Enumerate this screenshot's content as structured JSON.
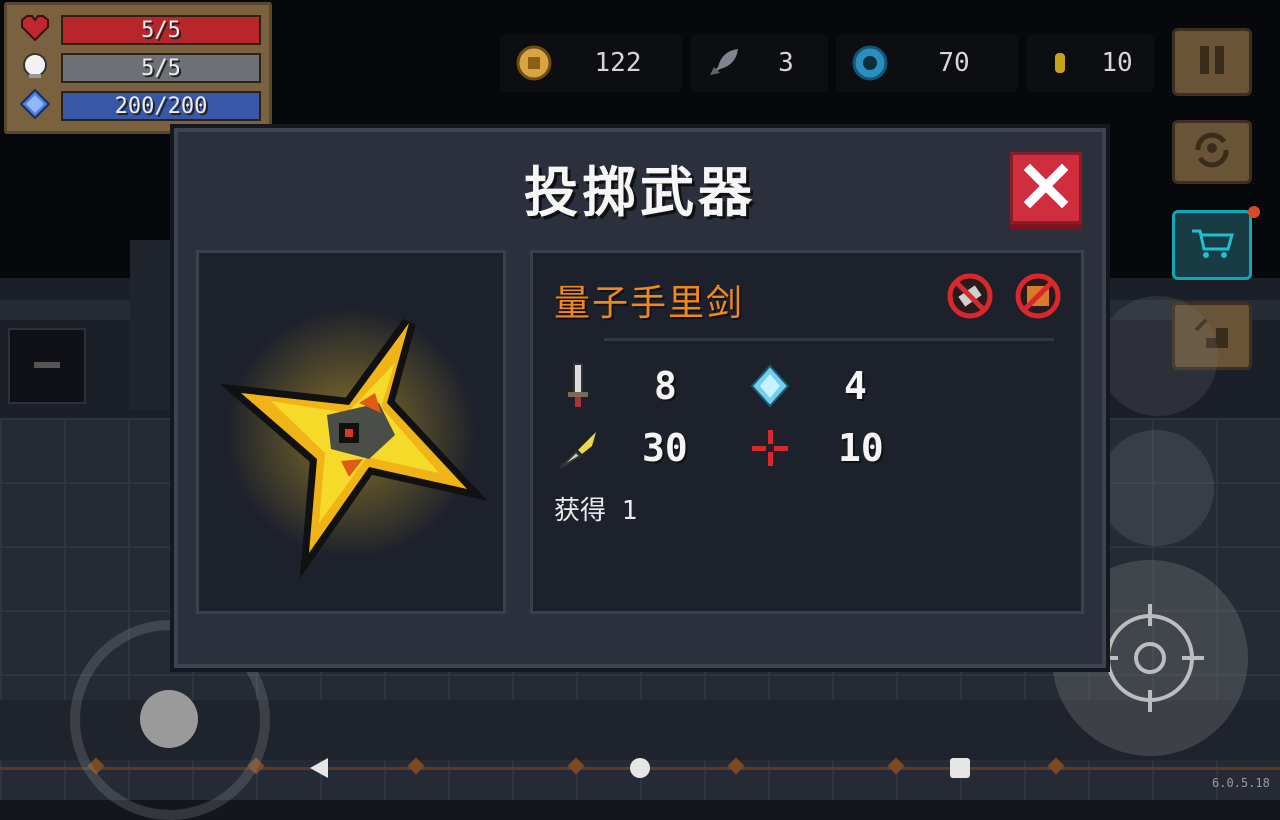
{
  "hud": {
    "health": {
      "text": "5/5",
      "fill": 1.0,
      "color": "#b8262c",
      "icon": "heart-icon"
    },
    "armor": {
      "text": "5/5",
      "fill": 1.0,
      "color": "#6d7076",
      "icon": "shield-icon"
    },
    "energy": {
      "text": "200/200",
      "fill": 1.0,
      "color": "#3857a6",
      "icon": "energy-crystal-icon"
    }
  },
  "currency": {
    "coins": {
      "value": "122",
      "icon": "coin-icon"
    },
    "fish": {
      "value": "3",
      "icon": "fish-icon"
    },
    "gems": {
      "value": "70",
      "icon": "gem-icon"
    },
    "seeds": {
      "value": "10",
      "icon": "seed-icon"
    }
  },
  "side_buttons": [
    "pause-icon",
    "swap-character-icon",
    "shop-cart-icon",
    "stairs-icon"
  ],
  "dialog": {
    "title": "投掷武器",
    "close_icon": "close-icon",
    "weapon": {
      "name": "量子手里剑",
      "name_color": "#f0891c",
      "restriction_icons": [
        "no-melee-icon",
        "no-chest-icon"
      ],
      "stats": {
        "damage": "8",
        "energy_cost": "4",
        "crit": "30",
        "spread": "10"
      },
      "obtained_label": "获得 1"
    }
  },
  "version": "6.0.5.18"
}
